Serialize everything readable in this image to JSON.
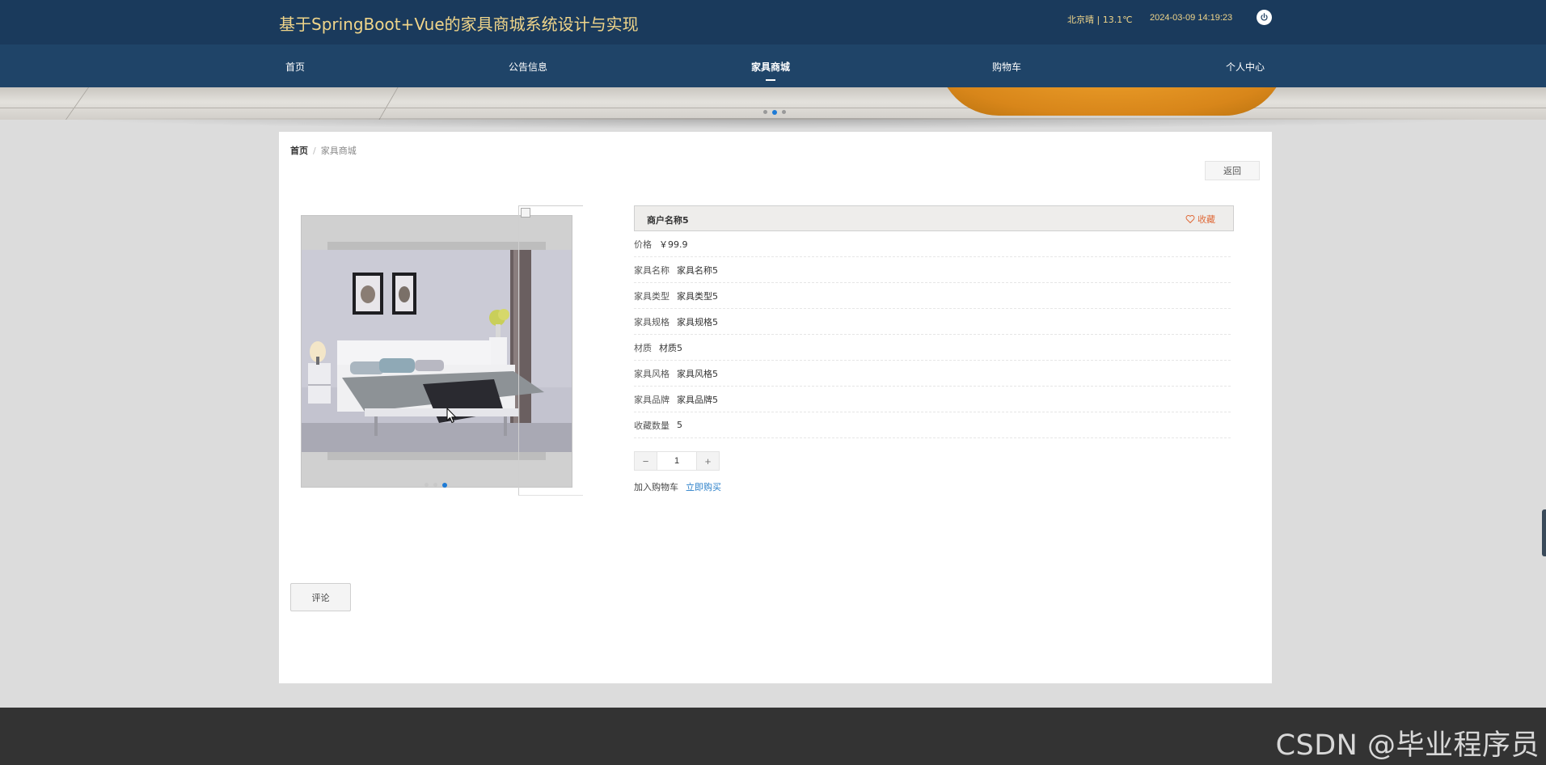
{
  "header": {
    "site_title": "基于SpringBoot+Vue的家具商城系统设计与实现",
    "weather": "北京晴 | 13.1℃",
    "datetime": "2024-03-09  14:19:23"
  },
  "nav": {
    "items": [
      {
        "label": "首页"
      },
      {
        "label": "公告信息"
      },
      {
        "label": "家具商城",
        "active": true
      },
      {
        "label": "购物车"
      },
      {
        "label": "个人中心"
      }
    ]
  },
  "breadcrumb": {
    "home": "首页",
    "separator": "/",
    "current": "家具商城"
  },
  "back_label": "返回",
  "product": {
    "merchant": "商户名称5",
    "favorite_label": "收藏",
    "details": [
      {
        "key": "价格",
        "value": "￥99.9"
      },
      {
        "key": "家具名称",
        "value": "家具名称5"
      },
      {
        "key": "家具类型",
        "value": "家具类型5"
      },
      {
        "key": "家具规格",
        "value": "家具规格5"
      },
      {
        "key": "材质",
        "value": "材质5"
      },
      {
        "key": "家具风格",
        "value": "家具风格5"
      },
      {
        "key": "家具品牌",
        "value": "家具品牌5"
      },
      {
        "key": "收藏数量",
        "value": "5"
      }
    ],
    "quantity": "1",
    "minus": "−",
    "plus": "+",
    "add_to_cart": "加入购物车",
    "buy_now": "立即购买"
  },
  "gallery": {
    "slides": 3,
    "active_slide": 3
  },
  "comment_label": "评论",
  "watermark": "CSDN @毕业程序员",
  "colors": {
    "topbar": "#1a3a5c",
    "navbar": "#1f4468",
    "title_gold": "#f0d58a",
    "accent_blue": "#1e7bd6",
    "favorite_orange": "#e06b3a",
    "link_blue": "#2a7fc9"
  },
  "icons": {
    "power": "power-icon",
    "favorite": "heart-outline-icon"
  }
}
